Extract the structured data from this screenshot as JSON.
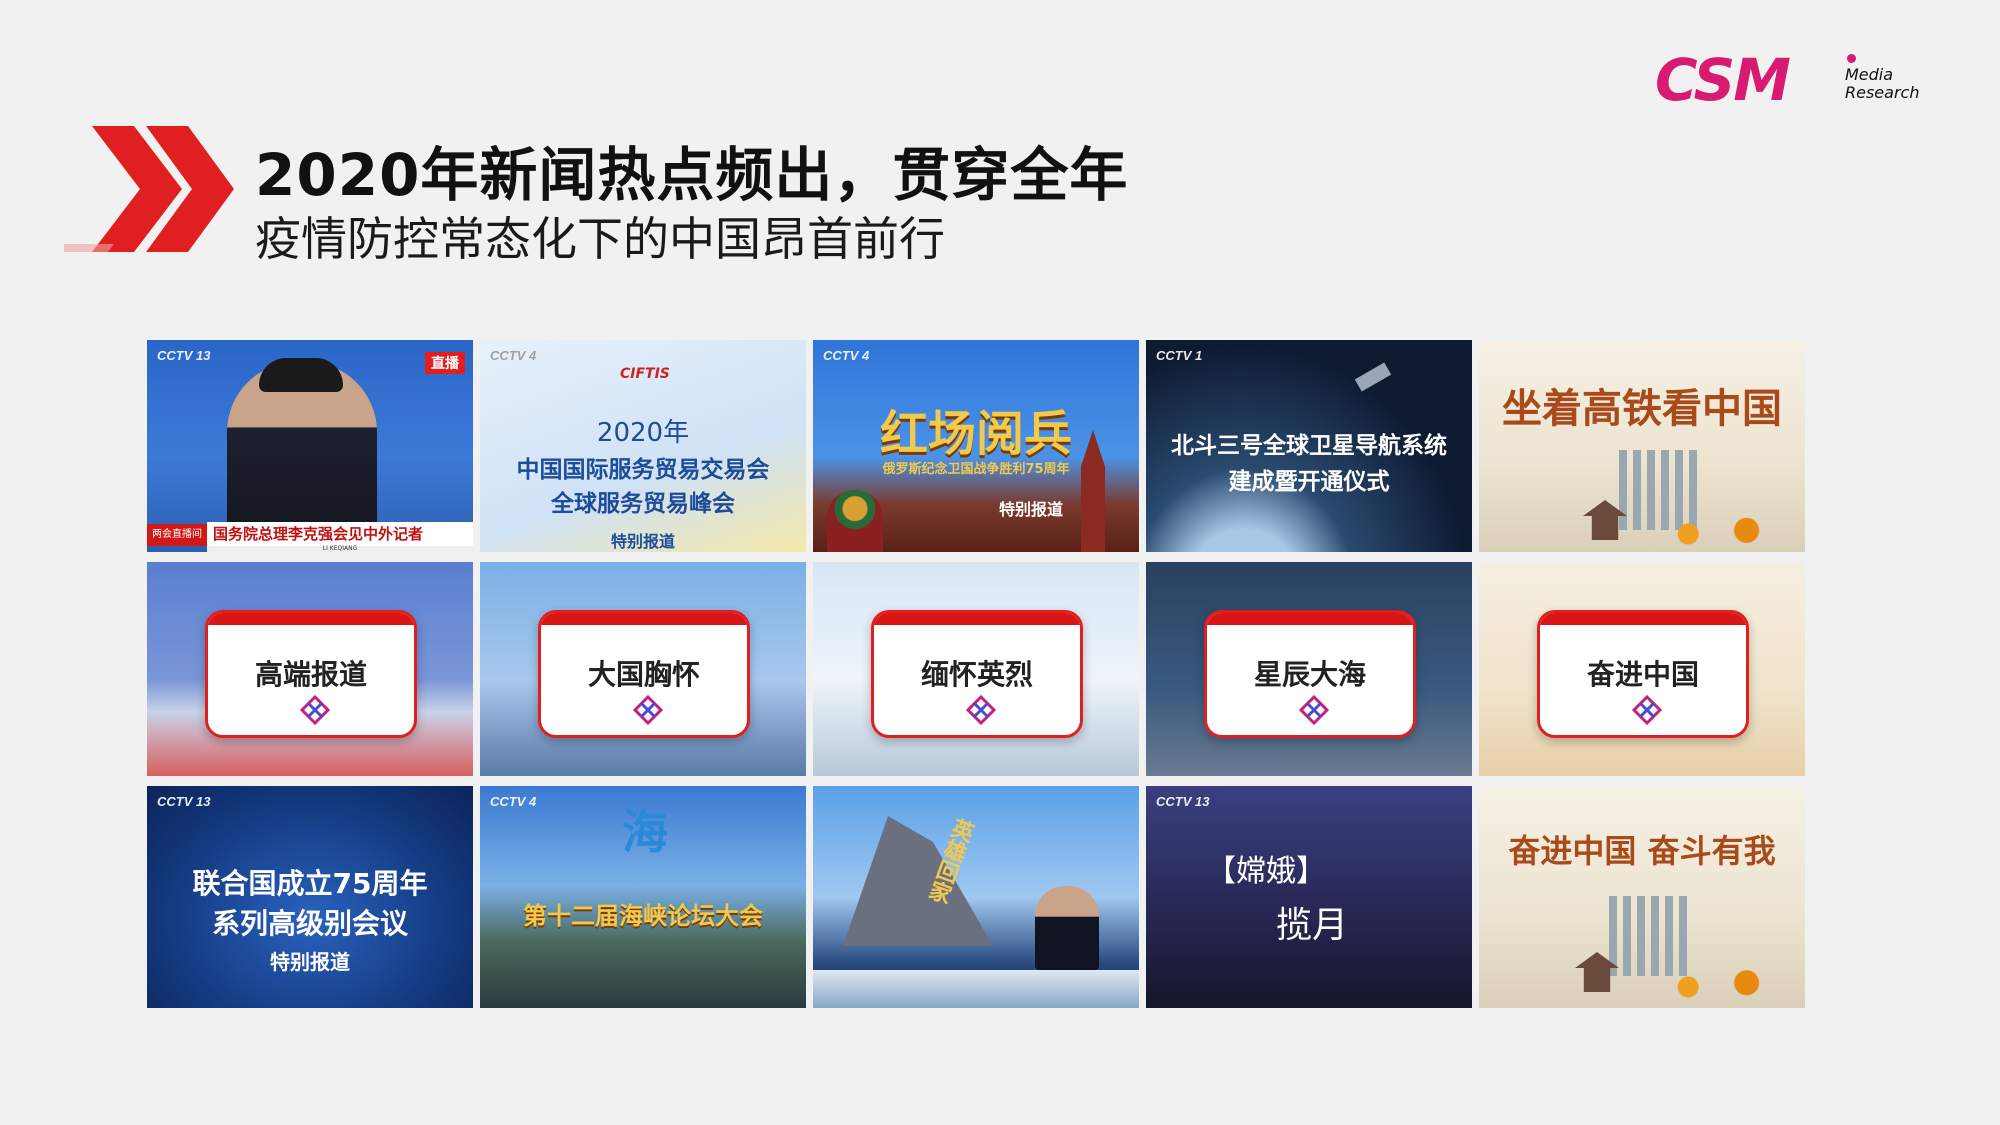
{
  "header": {
    "title": "2020年新闻热点频出，贯穿全年",
    "subtitle": "疫情防控常态化下的中国昂首前行"
  },
  "logo": {
    "main": "CSM",
    "line1": "Media",
    "line2": "Research"
  },
  "colors": {
    "accent_red": "#e02020",
    "logo_pink": "#d81b71"
  },
  "row1": [
    {
      "channel": "CCTV 13",
      "badge": "直播",
      "caption": "国务院总理李克强会见中外记者",
      "tag": "两会直播间",
      "name_line": "LI KEQIANG"
    },
    {
      "channel": "CCTV 4",
      "logo": "CIFTIS",
      "caption_lines": [
        "2020年",
        "中国国际服务贸易交易会",
        "全球服务贸易峰会"
      ],
      "sub": "特别报道"
    },
    {
      "channel": "CCTV 4",
      "caption": "红场阅兵",
      "sub_line": "俄罗斯纪念卫国战争胜利75周年",
      "sub": "特别报道"
    },
    {
      "channel": "CCTV 1",
      "caption_lines": [
        "北斗三号全球卫星导航系统",
        "建成暨开通仪式"
      ]
    },
    {
      "channel": "",
      "caption": "坐着高铁看中国"
    }
  ],
  "row2": [
    {
      "label": "高端报道",
      "icon": "csm-mark-icon"
    },
    {
      "label": "大国胸怀",
      "icon": "csm-mark-icon"
    },
    {
      "label": "缅怀英烈",
      "icon": "csm-mark-icon"
    },
    {
      "label": "星辰大海",
      "icon": "csm-mark-icon"
    },
    {
      "label": "奋进中国",
      "icon": "csm-mark-icon"
    }
  ],
  "row3": [
    {
      "channel": "CCTV 13",
      "caption_lines": [
        "联合国成立75周年",
        "系列高级别会议"
      ],
      "sub": "特别报道"
    },
    {
      "channel": "CCTV 4",
      "caption": "第十二届海峡论坛大会",
      "logo": "海"
    },
    {
      "channel": "",
      "caption": "英雄回家"
    },
    {
      "channel": "CCTV 13",
      "caption_lines": [
        "【嫦娥】",
        "揽月"
      ]
    },
    {
      "channel": "",
      "caption": "奋进中国 奋斗有我"
    }
  ]
}
